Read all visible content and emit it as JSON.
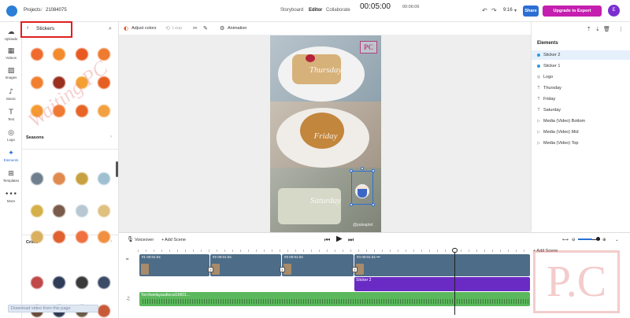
{
  "header": {
    "breadcrumb_projects": "Projects",
    "breadcrumb_sep": "/",
    "project_id": "21084075",
    "nav": [
      "Storyboard",
      "Editor",
      "Collaborate"
    ],
    "zoom": "9:16",
    "share_label": "Share",
    "upgrade_label": "Upgrade to Export",
    "avatar_letter": "E"
  },
  "rail": [
    {
      "label": "Uploads",
      "icon": "☁"
    },
    {
      "label": "Videos",
      "icon": "▦"
    },
    {
      "label": "Images",
      "icon": "▨"
    },
    {
      "label": "Music",
      "icon": "♪"
    },
    {
      "label": "Text",
      "icon": "T"
    },
    {
      "label": "Logo",
      "icon": "◎"
    },
    {
      "label": "Elements",
      "icon": "✦"
    },
    {
      "label": "Templates",
      "icon": "⊞"
    },
    {
      "label": "More",
      "icon": "•••"
    }
  ],
  "panel": {
    "back_icon": "‹",
    "title": "Stickers",
    "sections": [
      {
        "title": "Seasons",
        "more": "›"
      },
      {
        "title": "Crime",
        "more": "›"
      }
    ],
    "sticker_row_colors": [
      [
        "#f06a2e",
        "#f38a2b",
        "#e85a20",
        "#ee7b30"
      ],
      [
        "#f08030",
        "#9a3020",
        "#f4a030",
        "#e65f22"
      ],
      [
        "#f59a30",
        "#f07a30",
        "#e86424",
        "#f3a040"
      ],
      [
        "#6f7f8e",
        "#e08a50",
        "#c9a040",
        "#9fc0d0"
      ],
      [
        "#d4b04a",
        "#7a5a4a",
        "#b7c8d2",
        "#e0c080"
      ],
      [
        "#d9b060",
        "#e06030",
        "#f07040",
        "#f09040"
      ],
      [
        "#c04848",
        "#2e3c58",
        "#3a3a3a",
        "#3b4a66"
      ],
      [
        "#6b4a3a",
        "#2d3a50",
        "#6a5a48",
        "#c85a3a"
      ]
    ],
    "download_bar": "Download video from this page"
  },
  "watermark": {
    "text": "Waiting PC",
    "logo_text": "PC",
    "big_logo": "P.C"
  },
  "editor_toolbar": {
    "adjust_colors": "Adjust colors",
    "loop": "Loop",
    "animation": "Animation"
  },
  "canvas": {
    "labels": [
      "Thursday",
      "Friday",
      "Saturday"
    ],
    "video_watermark": "@paleaplet"
  },
  "elements_panel": {
    "title": "Elements",
    "items": [
      {
        "label": "Sticker 2",
        "kind": "dot",
        "selected": true
      },
      {
        "label": "Sticker 1",
        "kind": "dot",
        "selected": false
      },
      {
        "label": "Logo",
        "kind": "logo",
        "selected": false
      },
      {
        "label": "Thursday",
        "kind": "text",
        "selected": false
      },
      {
        "label": "Friday",
        "kind": "text",
        "selected": false
      },
      {
        "label": "Saturday",
        "kind": "text",
        "selected": false
      },
      {
        "label": "Media (Video) Bottom",
        "kind": "media",
        "selected": false
      },
      {
        "label": "Media (Video) Mid",
        "kind": "media",
        "selected": false
      },
      {
        "label": "Media (Video) Top",
        "kind": "media",
        "selected": false
      }
    ]
  },
  "timeline": {
    "voiceover_label": "Voiceover",
    "add_scene_label": "Add Scene",
    "current_time": "00:05:00",
    "total_time": "00:06:06",
    "add_scene_track": "+ Add Scene",
    "clips": [
      {
        "label": "#1 00:01:04"
      },
      {
        "label": "#2 00:01:04"
      },
      {
        "label": "#3 00:01:04"
      },
      {
        "label": "#4 00:01:24 •••"
      }
    ],
    "transition_mark": "x",
    "sticker_track": "Sticker 2",
    "audio_track": "Torchwelayaudiocut16601..."
  },
  "colors": {
    "accent": "#2b6fd4",
    "upgrade": "#c41fae",
    "sticker_track": "#6a2bc4",
    "audio_track": "#5bb85c",
    "clip": "#4d6c87"
  }
}
